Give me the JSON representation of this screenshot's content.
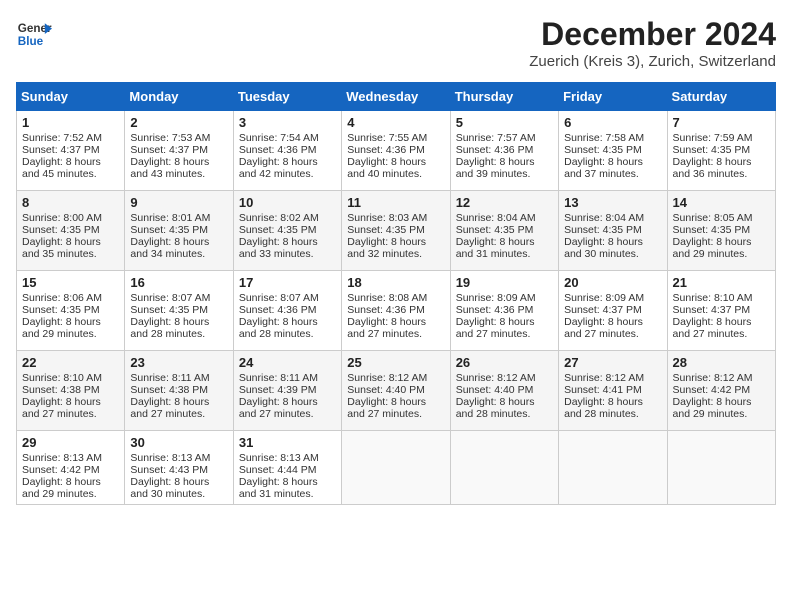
{
  "header": {
    "logo_line1": "General",
    "logo_line2": "Blue",
    "title": "December 2024",
    "subtitle": "Zuerich (Kreis 3), Zurich, Switzerland"
  },
  "calendar": {
    "days_of_week": [
      "Sunday",
      "Monday",
      "Tuesday",
      "Wednesday",
      "Thursday",
      "Friday",
      "Saturday"
    ],
    "weeks": [
      [
        {
          "day": "1",
          "sunrise": "Sunrise: 7:52 AM",
          "sunset": "Sunset: 4:37 PM",
          "daylight": "Daylight: 8 hours and 45 minutes."
        },
        {
          "day": "2",
          "sunrise": "Sunrise: 7:53 AM",
          "sunset": "Sunset: 4:37 PM",
          "daylight": "Daylight: 8 hours and 43 minutes."
        },
        {
          "day": "3",
          "sunrise": "Sunrise: 7:54 AM",
          "sunset": "Sunset: 4:36 PM",
          "daylight": "Daylight: 8 hours and 42 minutes."
        },
        {
          "day": "4",
          "sunrise": "Sunrise: 7:55 AM",
          "sunset": "Sunset: 4:36 PM",
          "daylight": "Daylight: 8 hours and 40 minutes."
        },
        {
          "day": "5",
          "sunrise": "Sunrise: 7:57 AM",
          "sunset": "Sunset: 4:36 PM",
          "daylight": "Daylight: 8 hours and 39 minutes."
        },
        {
          "day": "6",
          "sunrise": "Sunrise: 7:58 AM",
          "sunset": "Sunset: 4:35 PM",
          "daylight": "Daylight: 8 hours and 37 minutes."
        },
        {
          "day": "7",
          "sunrise": "Sunrise: 7:59 AM",
          "sunset": "Sunset: 4:35 PM",
          "daylight": "Daylight: 8 hours and 36 minutes."
        }
      ],
      [
        {
          "day": "8",
          "sunrise": "Sunrise: 8:00 AM",
          "sunset": "Sunset: 4:35 PM",
          "daylight": "Daylight: 8 hours and 35 minutes."
        },
        {
          "day": "9",
          "sunrise": "Sunrise: 8:01 AM",
          "sunset": "Sunset: 4:35 PM",
          "daylight": "Daylight: 8 hours and 34 minutes."
        },
        {
          "day": "10",
          "sunrise": "Sunrise: 8:02 AM",
          "sunset": "Sunset: 4:35 PM",
          "daylight": "Daylight: 8 hours and 33 minutes."
        },
        {
          "day": "11",
          "sunrise": "Sunrise: 8:03 AM",
          "sunset": "Sunset: 4:35 PM",
          "daylight": "Daylight: 8 hours and 32 minutes."
        },
        {
          "day": "12",
          "sunrise": "Sunrise: 8:04 AM",
          "sunset": "Sunset: 4:35 PM",
          "daylight": "Daylight: 8 hours and 31 minutes."
        },
        {
          "day": "13",
          "sunrise": "Sunrise: 8:04 AM",
          "sunset": "Sunset: 4:35 PM",
          "daylight": "Daylight: 8 hours and 30 minutes."
        },
        {
          "day": "14",
          "sunrise": "Sunrise: 8:05 AM",
          "sunset": "Sunset: 4:35 PM",
          "daylight": "Daylight: 8 hours and 29 minutes."
        }
      ],
      [
        {
          "day": "15",
          "sunrise": "Sunrise: 8:06 AM",
          "sunset": "Sunset: 4:35 PM",
          "daylight": "Daylight: 8 hours and 29 minutes."
        },
        {
          "day": "16",
          "sunrise": "Sunrise: 8:07 AM",
          "sunset": "Sunset: 4:35 PM",
          "daylight": "Daylight: 8 hours and 28 minutes."
        },
        {
          "day": "17",
          "sunrise": "Sunrise: 8:07 AM",
          "sunset": "Sunset: 4:36 PM",
          "daylight": "Daylight: 8 hours and 28 minutes."
        },
        {
          "day": "18",
          "sunrise": "Sunrise: 8:08 AM",
          "sunset": "Sunset: 4:36 PM",
          "daylight": "Daylight: 8 hours and 27 minutes."
        },
        {
          "day": "19",
          "sunrise": "Sunrise: 8:09 AM",
          "sunset": "Sunset: 4:36 PM",
          "daylight": "Daylight: 8 hours and 27 minutes."
        },
        {
          "day": "20",
          "sunrise": "Sunrise: 8:09 AM",
          "sunset": "Sunset: 4:37 PM",
          "daylight": "Daylight: 8 hours and 27 minutes."
        },
        {
          "day": "21",
          "sunrise": "Sunrise: 8:10 AM",
          "sunset": "Sunset: 4:37 PM",
          "daylight": "Daylight: 8 hours and 27 minutes."
        }
      ],
      [
        {
          "day": "22",
          "sunrise": "Sunrise: 8:10 AM",
          "sunset": "Sunset: 4:38 PM",
          "daylight": "Daylight: 8 hours and 27 minutes."
        },
        {
          "day": "23",
          "sunrise": "Sunrise: 8:11 AM",
          "sunset": "Sunset: 4:38 PM",
          "daylight": "Daylight: 8 hours and 27 minutes."
        },
        {
          "day": "24",
          "sunrise": "Sunrise: 8:11 AM",
          "sunset": "Sunset: 4:39 PM",
          "daylight": "Daylight: 8 hours and 27 minutes."
        },
        {
          "day": "25",
          "sunrise": "Sunrise: 8:12 AM",
          "sunset": "Sunset: 4:40 PM",
          "daylight": "Daylight: 8 hours and 27 minutes."
        },
        {
          "day": "26",
          "sunrise": "Sunrise: 8:12 AM",
          "sunset": "Sunset: 4:40 PM",
          "daylight": "Daylight: 8 hours and 28 minutes."
        },
        {
          "day": "27",
          "sunrise": "Sunrise: 8:12 AM",
          "sunset": "Sunset: 4:41 PM",
          "daylight": "Daylight: 8 hours and 28 minutes."
        },
        {
          "day": "28",
          "sunrise": "Sunrise: 8:12 AM",
          "sunset": "Sunset: 4:42 PM",
          "daylight": "Daylight: 8 hours and 29 minutes."
        }
      ],
      [
        {
          "day": "29",
          "sunrise": "Sunrise: 8:13 AM",
          "sunset": "Sunset: 4:42 PM",
          "daylight": "Daylight: 8 hours and 29 minutes."
        },
        {
          "day": "30",
          "sunrise": "Sunrise: 8:13 AM",
          "sunset": "Sunset: 4:43 PM",
          "daylight": "Daylight: 8 hours and 30 minutes."
        },
        {
          "day": "31",
          "sunrise": "Sunrise: 8:13 AM",
          "sunset": "Sunset: 4:44 PM",
          "daylight": "Daylight: 8 hours and 31 minutes."
        },
        null,
        null,
        null,
        null
      ]
    ]
  }
}
